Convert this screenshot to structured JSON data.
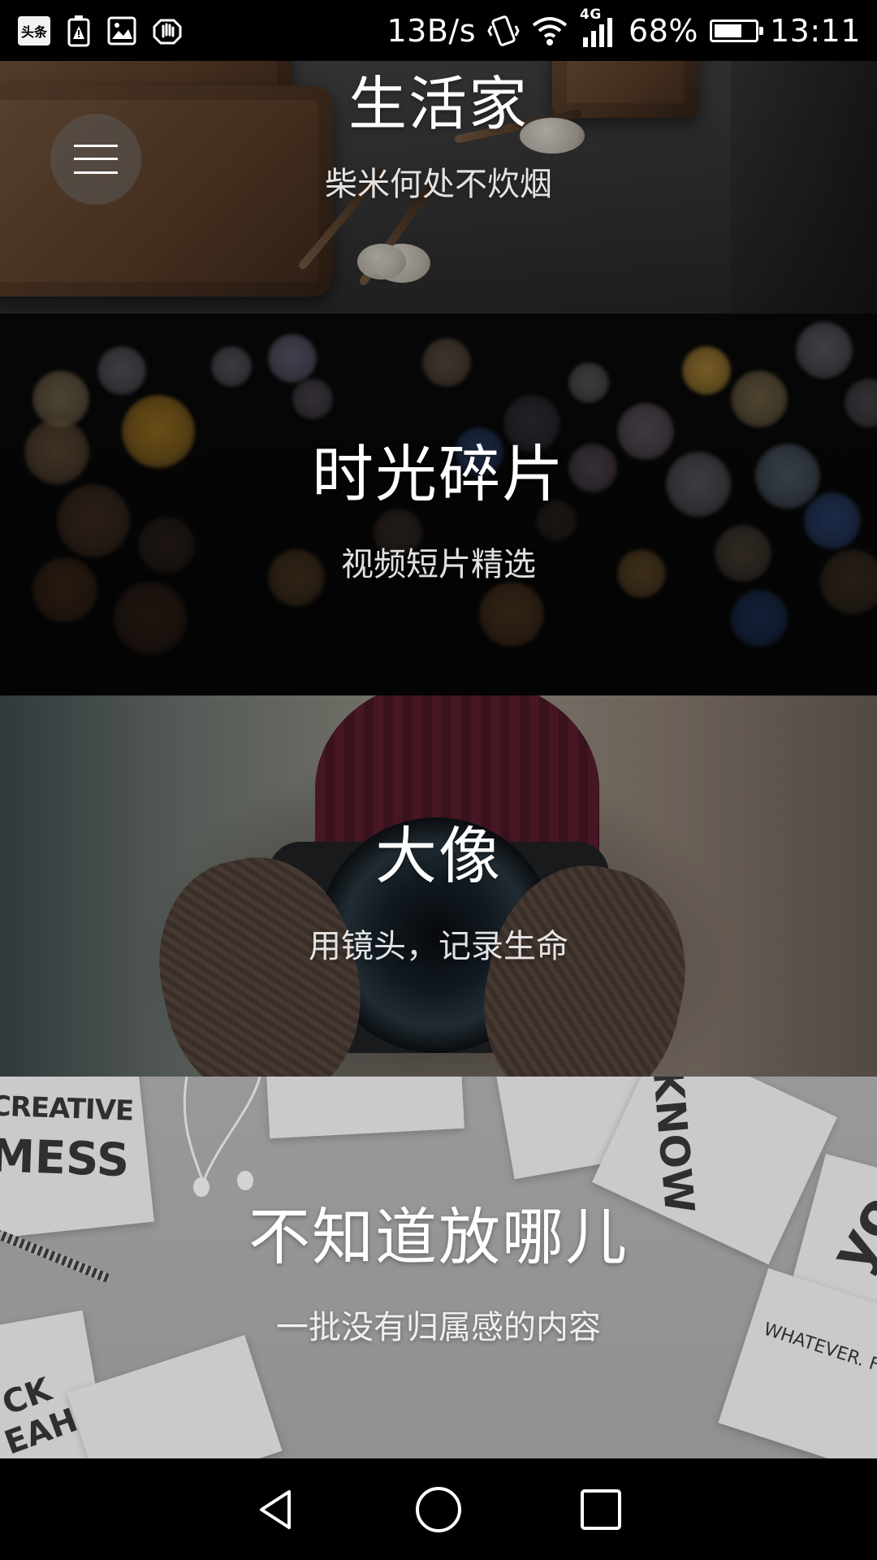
{
  "status_bar": {
    "app_badge": "头条",
    "net_speed": "13B/s",
    "network_type": "4G",
    "battery_pct": "68%",
    "battery_level": 0.68,
    "time": "13:11",
    "icons": [
      "toutiao-app-icon",
      "battery-alert-icon",
      "image-icon",
      "hand-icon",
      "vibrate-icon",
      "wifi-icon",
      "signal-icon",
      "battery-icon"
    ]
  },
  "menu": {
    "icon": "hamburger-menu-icon"
  },
  "cards": [
    {
      "title": "生活家",
      "subtitle": "柴米何处不炊烟"
    },
    {
      "title": "时光碎片",
      "subtitle": "视频短片精选"
    },
    {
      "title": "大像",
      "subtitle": "用镜头，记录生命"
    },
    {
      "title": "不知道放哪儿",
      "subtitle": "一批没有归属感的内容"
    }
  ],
  "poster_texts": {
    "creative": "CREATIVE",
    "mess": "MESS",
    "know": "KNOW",
    "yo": "yo",
    "whatever": "WHATEVER. FU",
    "ck": "CK",
    "eah": "EAH!"
  },
  "nav_bar": {
    "icons": [
      "back-icon",
      "home-icon",
      "recents-icon"
    ]
  }
}
